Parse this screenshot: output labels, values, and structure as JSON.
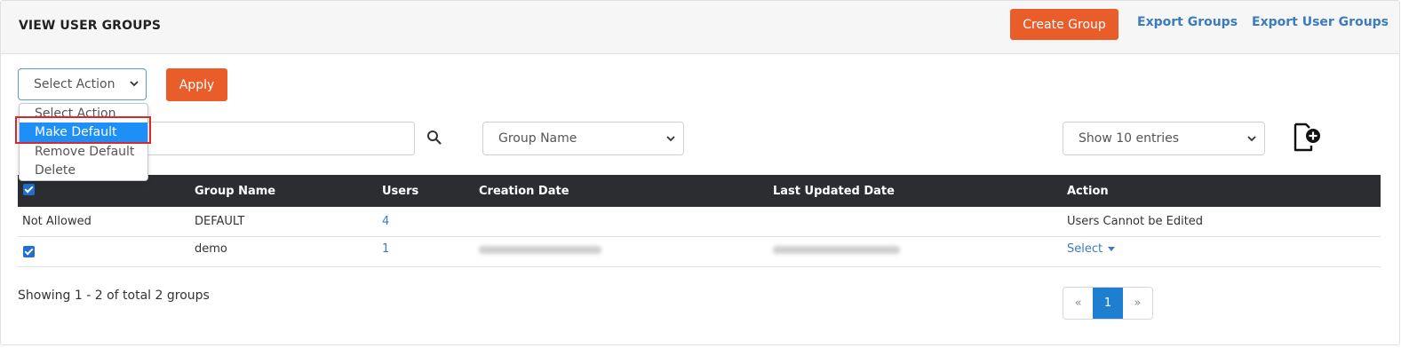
{
  "header": {
    "title": "VIEW USER GROUPS",
    "create_group": "Create Group",
    "export_groups": "Export Groups",
    "export_user_groups": "Export User Groups"
  },
  "bulk_action": {
    "selected": "Select Action",
    "apply": "Apply",
    "options": [
      "Select Action",
      "Make Default",
      "Remove Default",
      "Delete"
    ],
    "highlighted_option": "Make Default"
  },
  "search": {
    "placeholder": "",
    "value": ""
  },
  "filter": {
    "group_field": "Group Name",
    "entries": "Show 10 entries"
  },
  "table": {
    "columns": [
      "",
      "Group Name",
      "Users",
      "Creation Date",
      "Last Updated Date",
      "Action"
    ],
    "rows": [
      {
        "select": "Not Allowed",
        "group_name": "DEFAULT",
        "users": "4",
        "creation_date": "",
        "last_updated": "",
        "action": "Users Cannot be Edited"
      },
      {
        "select": "checked",
        "group_name": "demo",
        "users": "1",
        "creation_date": "(blurred)",
        "last_updated": "(blurred)",
        "action": "Select"
      }
    ]
  },
  "footer": {
    "summary": "Showing 1 - 2 of total 2 groups",
    "pagination": {
      "prev": "«",
      "current": "1",
      "next": "»"
    }
  },
  "colors": {
    "accent": "#e85d2a",
    "link": "#3b7bc0",
    "header_bg": "#2b2d31",
    "highlight": "#1e8ff7",
    "annotation": "#d6282f"
  },
  "icons": [
    "chevron-down-icon",
    "search-icon",
    "add-document-icon",
    "checkbox-icon",
    "caret-down-icon"
  ]
}
